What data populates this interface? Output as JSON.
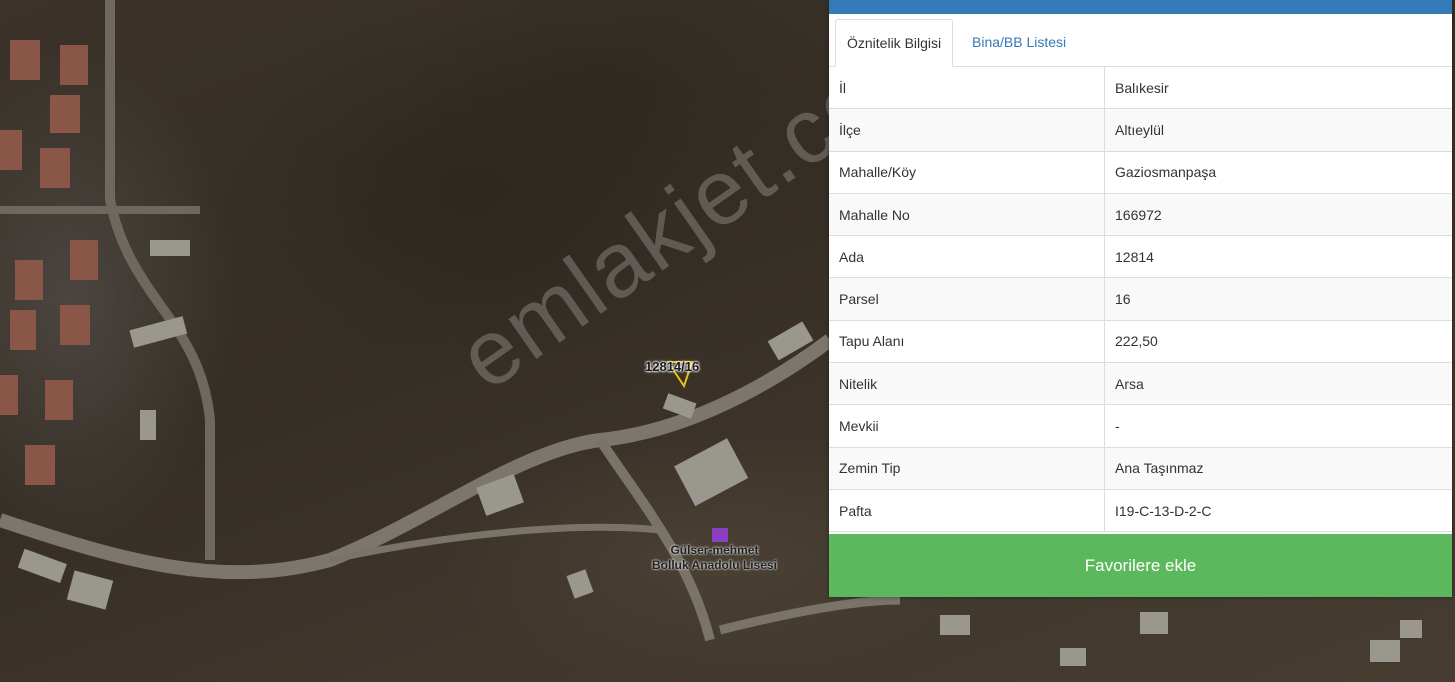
{
  "map": {
    "watermark": "emlakjet.com",
    "parcel_label": "12814/16",
    "school_label_line1": "Gülser-mehmet",
    "school_label_line2": "Bolluk Anadolu Lisesi"
  },
  "panel": {
    "tabs": [
      {
        "label": "Öznitelik Bilgisi",
        "active": true
      },
      {
        "label": "Bina/BB Listesi",
        "active": false
      }
    ],
    "rows": [
      {
        "key": "İl",
        "value": "Balıkesir"
      },
      {
        "key": "İlçe",
        "value": "Altıeylül"
      },
      {
        "key": "Mahalle/Köy",
        "value": "Gaziosmanpaşa"
      },
      {
        "key": "Mahalle No",
        "value": "166972"
      },
      {
        "key": "Ada",
        "value": "12814"
      },
      {
        "key": "Parsel",
        "value": "16"
      },
      {
        "key": "Tapu Alanı",
        "value": "222,50"
      },
      {
        "key": "Nitelik",
        "value": "Arsa"
      },
      {
        "key": "Mevkii",
        "value": "-"
      },
      {
        "key": "Zemin Tip",
        "value": "Ana Taşınmaz"
      },
      {
        "key": "Pafta",
        "value": "I19-C-13-D-2-C"
      }
    ],
    "favorite_button": "Favorilere ekle"
  },
  "colors": {
    "header_blue": "#337ab7",
    "button_green": "#5cb85c",
    "link_blue": "#337ab7"
  }
}
